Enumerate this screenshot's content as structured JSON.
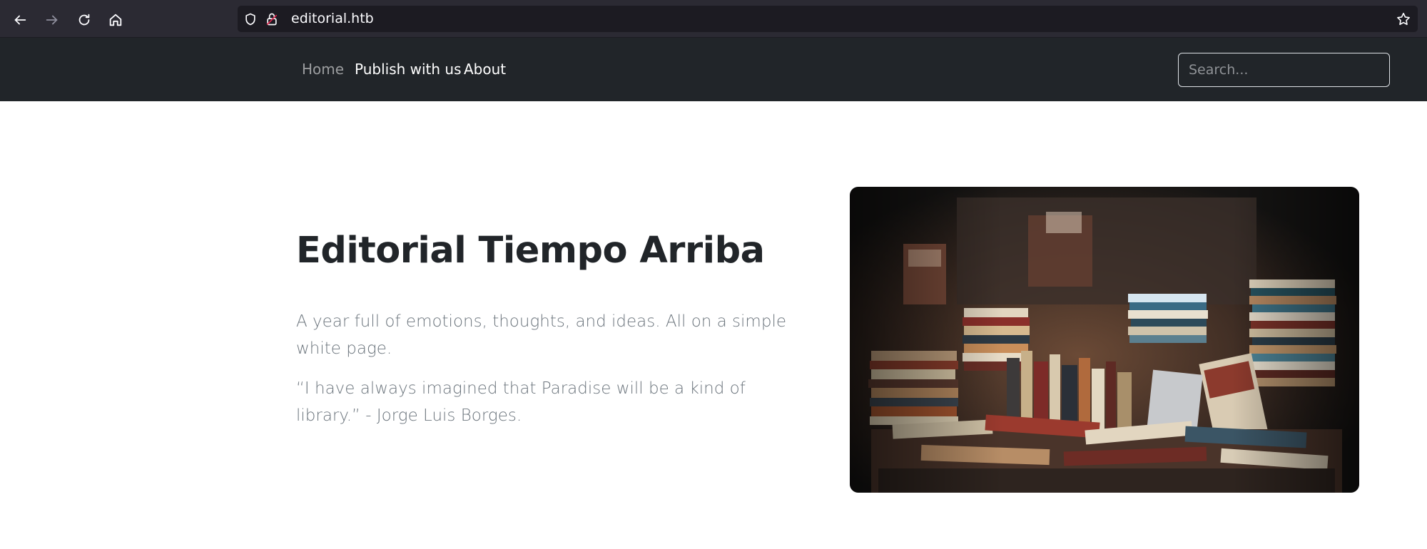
{
  "browser": {
    "url": "editorial.htb",
    "icons": {
      "back": "arrow-left-icon",
      "forward": "arrow-right-icon",
      "reload": "reload-icon",
      "home": "home-icon",
      "tracking": "shield-icon",
      "security": "insecure-lock-icon",
      "bookmark": "star-icon"
    }
  },
  "navbar": {
    "links": [
      {
        "label": "Home",
        "active": true
      },
      {
        "label": "Publish with us",
        "active": false
      },
      {
        "label": "About",
        "active": false
      }
    ],
    "search": {
      "placeholder": "Search...",
      "value": ""
    }
  },
  "hero": {
    "title": "Editorial Tiempo Arriba",
    "paragraphs": [
      "A year full of emotions, thoughts, and ideas. All on a simple white page.",
      "“I have always imagined that Paradise will be a kind of library.” - Jorge Luis Borges."
    ],
    "image": {
      "subject": "stacks of old books in a dim library"
    }
  },
  "colors": {
    "browser_bg": "#2b2a33",
    "urlbar_bg": "#1c1b22",
    "navbar_bg": "#212529",
    "title_color": "#212529",
    "text_color": "#6c757d",
    "nav_active": "rgba(255,255,255,0.55)"
  }
}
